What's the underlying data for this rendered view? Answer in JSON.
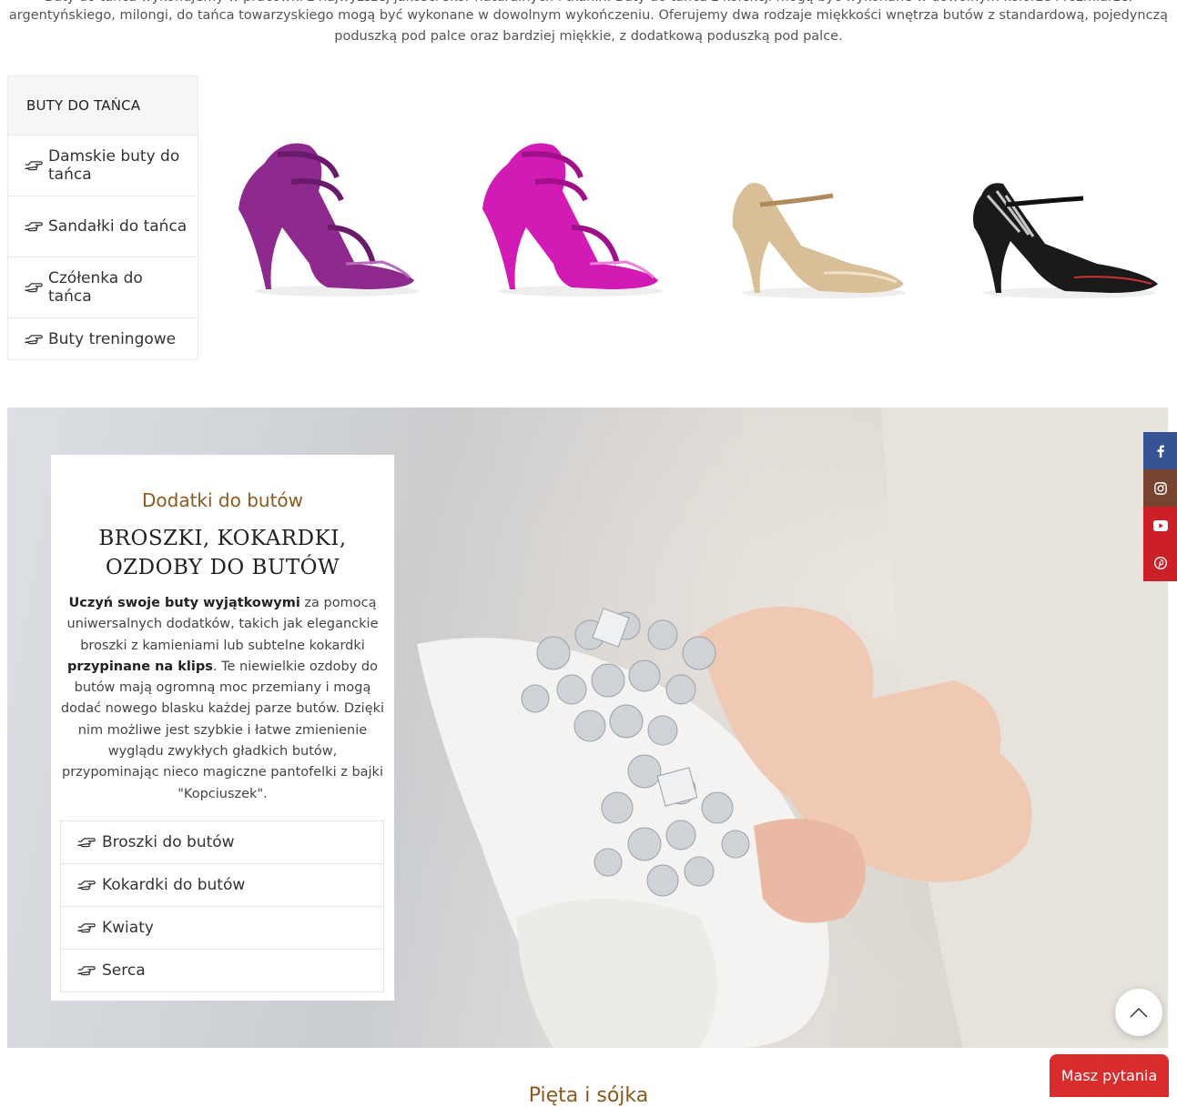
{
  "intro": {
    "line0": "Buty do tańca wykonujemy w pracowni z najwyższej jakości skór naturalnych i tkanin. Buty do tańca z kolekcji mogą być wykonane w dowolnym kolorze i rozmiarze.",
    "line1": "argentyńskiego, milongi, do tańca towarzyskiego mogą być wykonane w dowolnym wykończeniu. Oferujemy dwa rodzaje miękkości wnętrza butów z standardową, pojedynczą",
    "line2": "poduszką pod palce oraz bardziej miękkie, z dodatkową poduszką pod palce."
  },
  "categories": {
    "title": "BUTY DO TAŃCA",
    "items": [
      {
        "label": "Damskie buty do tańca"
      },
      {
        "label": "Sandałki do tańca"
      },
      {
        "label": "Czółenka do tańca"
      },
      {
        "label": "Buty treningowe"
      }
    ]
  },
  "shoes": [
    {
      "icon": "purple-sandal-image",
      "color": "#8e2a8e"
    },
    {
      "icon": "pink-sandal-image",
      "color": "#d21ab4"
    },
    {
      "icon": "gold-pump-image",
      "color": "#d8bf97"
    },
    {
      "icon": "black-silver-pump-image",
      "color": "#1a1a1a"
    }
  ],
  "accessories": {
    "subtitle": "Dodatki do butów",
    "title": "BROSZKI, KOKARDKI, OZDOBY DO BUTÓW",
    "text": {
      "b1": "Uczyń swoje buty wyjątkowymi",
      "t1": " za pomocą uniwersalnych dodatków, takich jak eleganckie broszki z kamieniami lub subtelne kokardki ",
      "b2": "przypinane na klips",
      "t2": ". Te niewielkie ozdoby do butów mają ogromną moc przemiany i mogą dodać nowego blasku każdej parze butów. Dzięki nim możliwe jest szybkie i łatwe zmienienie wyglądu zwykłych gładkich butów, przypominając nieco magiczne pantofelki z bajki \"Kopciuszek\"."
    },
    "items": [
      {
        "label": "Broszki do butów"
      },
      {
        "label": "Kokardki do butów"
      },
      {
        "label": "Kwiaty"
      },
      {
        "label": "Serca"
      }
    ]
  },
  "social": [
    {
      "name": "facebook",
      "icon": "facebook-icon",
      "color": "#365493"
    },
    {
      "name": "instagram",
      "icon": "instagram-icon",
      "color": "#774430"
    },
    {
      "name": "youtube",
      "icon": "youtube-icon",
      "color": "#cb2027"
    },
    {
      "name": "pinterest",
      "icon": "pinterest-icon",
      "color": "#cb2027"
    }
  ],
  "chat": {
    "label": "Masz pytania"
  },
  "next_heading": "Pięta i sójka",
  "colors": {
    "accent": "#8a5a1c",
    "chat": "#d92c2c"
  }
}
